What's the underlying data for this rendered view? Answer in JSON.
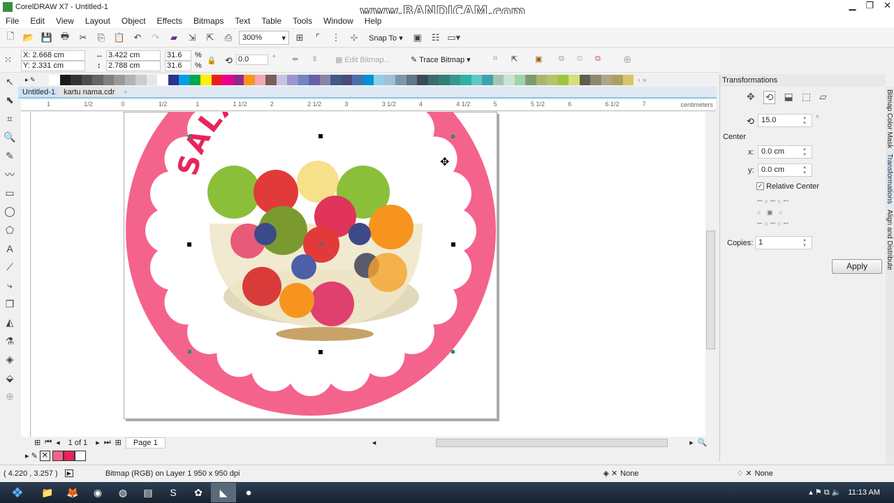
{
  "window": {
    "title": "CorelDRAW X7 - Untitled-1",
    "watermark": "www.BANDICAM.com"
  },
  "menu": [
    "File",
    "Edit",
    "View",
    "Layout",
    "Object",
    "Effects",
    "Bitmaps",
    "Text",
    "Table",
    "Tools",
    "Window",
    "Help"
  ],
  "toolbar": {
    "zoom": "300%",
    "snap_to": "Snap To"
  },
  "propbar": {
    "x": "X: 2.668 cm",
    "y": "Y: 2.331 cm",
    "w": "3.422 cm",
    "h": "2.788 cm",
    "scale_w": "31.6",
    "scale_h": "31.6",
    "pct": "%",
    "rotation": "0.0",
    "degree": "°",
    "edit_bitmap": "Edit Bitmap...",
    "trace_bitmap": "Trace Bitmap"
  },
  "palette": [
    "#ffffff",
    "#1a1a1a",
    "#333333",
    "#4d4d4d",
    "#666666",
    "#808080",
    "#999999",
    "#b3b3b3",
    "#cccccc",
    "#e6e6e6",
    "#ffffff",
    "#2e3192",
    "#00a0e3",
    "#00a651",
    "#fff200",
    "#ed1c24",
    "#ec008c",
    "#92278f",
    "#f7941d",
    "#f4a6b4",
    "#7b5e57",
    "#c5c4e3",
    "#9b97cc",
    "#6e85c1",
    "#6a5fa6",
    "#8884a8",
    "#3d5a8a",
    "#4a4a78",
    "#4b6fa8",
    "#0091d5",
    "#8ecfe8",
    "#9fc0d4",
    "#7d97a8",
    "#5e7686",
    "#3b4b58",
    "#3e6b6b",
    "#2f8076",
    "#37998d",
    "#2cb3a4",
    "#5ec7c4",
    "#41a3a9",
    "#a5c4b5",
    "#c8e4d2",
    "#9ed3ab",
    "#7e9a72",
    "#a8b86a",
    "#b4c46c",
    "#9fc43e",
    "#d4e07e",
    "#5e5e4a",
    "#8a8a6e",
    "#aea58a",
    "#b0a060",
    "#d9c46a"
  ],
  "tabs": [
    "Untitled-1",
    "kartu nama.cdr"
  ],
  "ruler": {
    "labels": [
      "1",
      "1/2",
      "0",
      "1/2",
      "1",
      "1 1/2",
      "2",
      "2 1/2",
      "3",
      "3 1/2",
      "4",
      "4 1/2",
      "5",
      "5 1/2",
      "6",
      "6 1/2",
      "7"
    ],
    "unit": "centimeters"
  },
  "artwork": {
    "title_text": "SALAD BUAHKU",
    "ring_color": "#f4638c",
    "text_color": "#e8245c"
  },
  "pagenav": {
    "pages": "1 of 1",
    "page_tab": "Page 1"
  },
  "doc_palette": [
    "#f4638c",
    "#e8245c",
    "#ffffff"
  ],
  "status": {
    "coords": "( 4.220 , 3.257 )",
    "info": "Bitmap (RGB) on Layer 1 950 x 950 dpi",
    "fill": "None",
    "outline": "None"
  },
  "docker": {
    "title": "Transformations",
    "angle": "15.0",
    "degree": "°",
    "center_label": "Center",
    "x_label": "x:",
    "x_value": "0.0 cm",
    "y_label": "y:",
    "y_value": "0.0 cm",
    "relative_center": "Relative Center",
    "relative_checked": true,
    "copies_label": "Copies:",
    "copies": "1",
    "apply": "Apply"
  },
  "vtabs": [
    "Bitmap Color Mask",
    "Transformations",
    "Align and Distribute"
  ],
  "taskbar": {
    "time": "11:13 AM"
  }
}
